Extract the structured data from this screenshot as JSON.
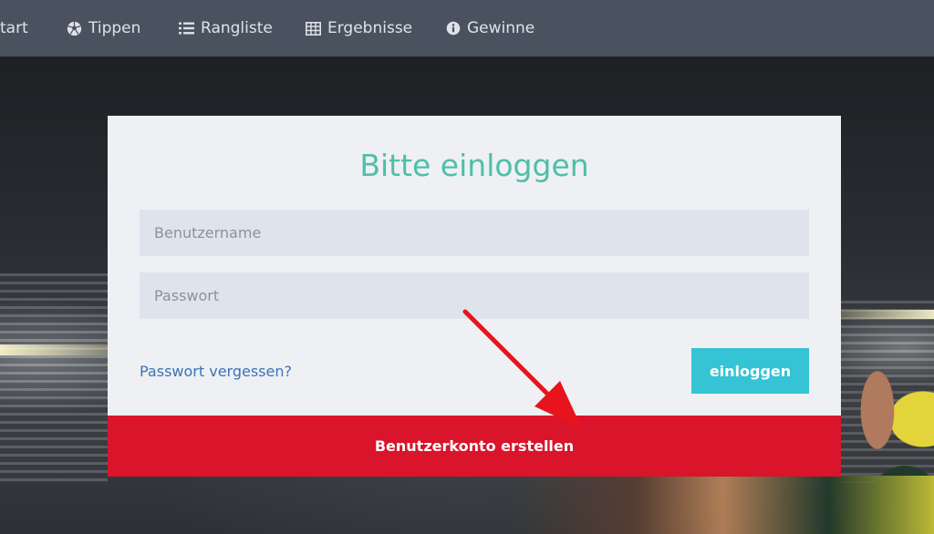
{
  "nav": {
    "items": [
      {
        "label": "tart",
        "icon": "home-icon"
      },
      {
        "label": "Tippen",
        "icon": "soccer-ball-icon"
      },
      {
        "label": "Rangliste",
        "icon": "list-ordered-icon"
      },
      {
        "label": "Ergebnisse",
        "icon": "table-icon"
      },
      {
        "label": "Gewinne",
        "icon": "info-circle-icon"
      }
    ]
  },
  "login": {
    "title": "Bitte einloggen",
    "username_placeholder": "Benutzername",
    "password_placeholder": "Passwort",
    "forgot_password": "Passwort vergessen?",
    "login_button": "einloggen",
    "register_button": "Benutzerkonto erstellen"
  },
  "colors": {
    "navbar": "#4a5260",
    "title": "#4fbfa8",
    "login_button": "#35c3d6",
    "register_button": "#d9142b",
    "link": "#3a73b5",
    "annotation_arrow": "#e8141c"
  }
}
